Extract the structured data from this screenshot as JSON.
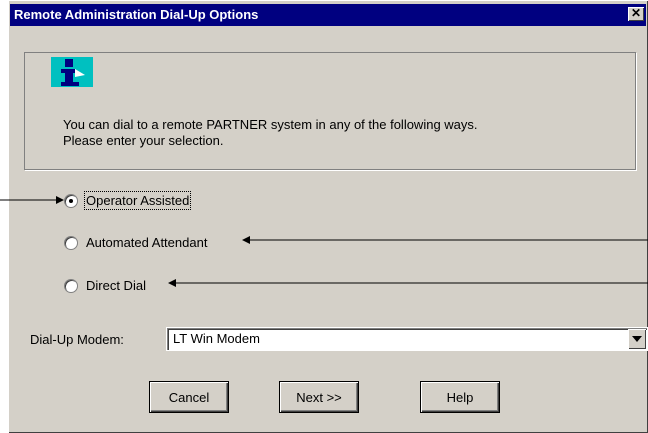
{
  "window": {
    "title": "Remote Administration Dial-Up Options",
    "close_glyph": "✕"
  },
  "info": {
    "icon": "info-icon",
    "line1": "You can dial to a remote PARTNER system in any of the following ways.",
    "line2": "Please enter your selection."
  },
  "options": [
    {
      "label": "Operator Assisted",
      "checked": true
    },
    {
      "label": "Automated Attendant",
      "checked": false
    },
    {
      "label": "Direct Dial",
      "checked": false
    }
  ],
  "modem": {
    "label": "Dial-Up Modem:",
    "value": "LT Win Modem"
  },
  "buttons": {
    "cancel": "Cancel",
    "next": "Next >>",
    "help": "Help"
  },
  "colors": {
    "title_bg": "#000080",
    "dialog_bg": "#d4d0c8"
  }
}
